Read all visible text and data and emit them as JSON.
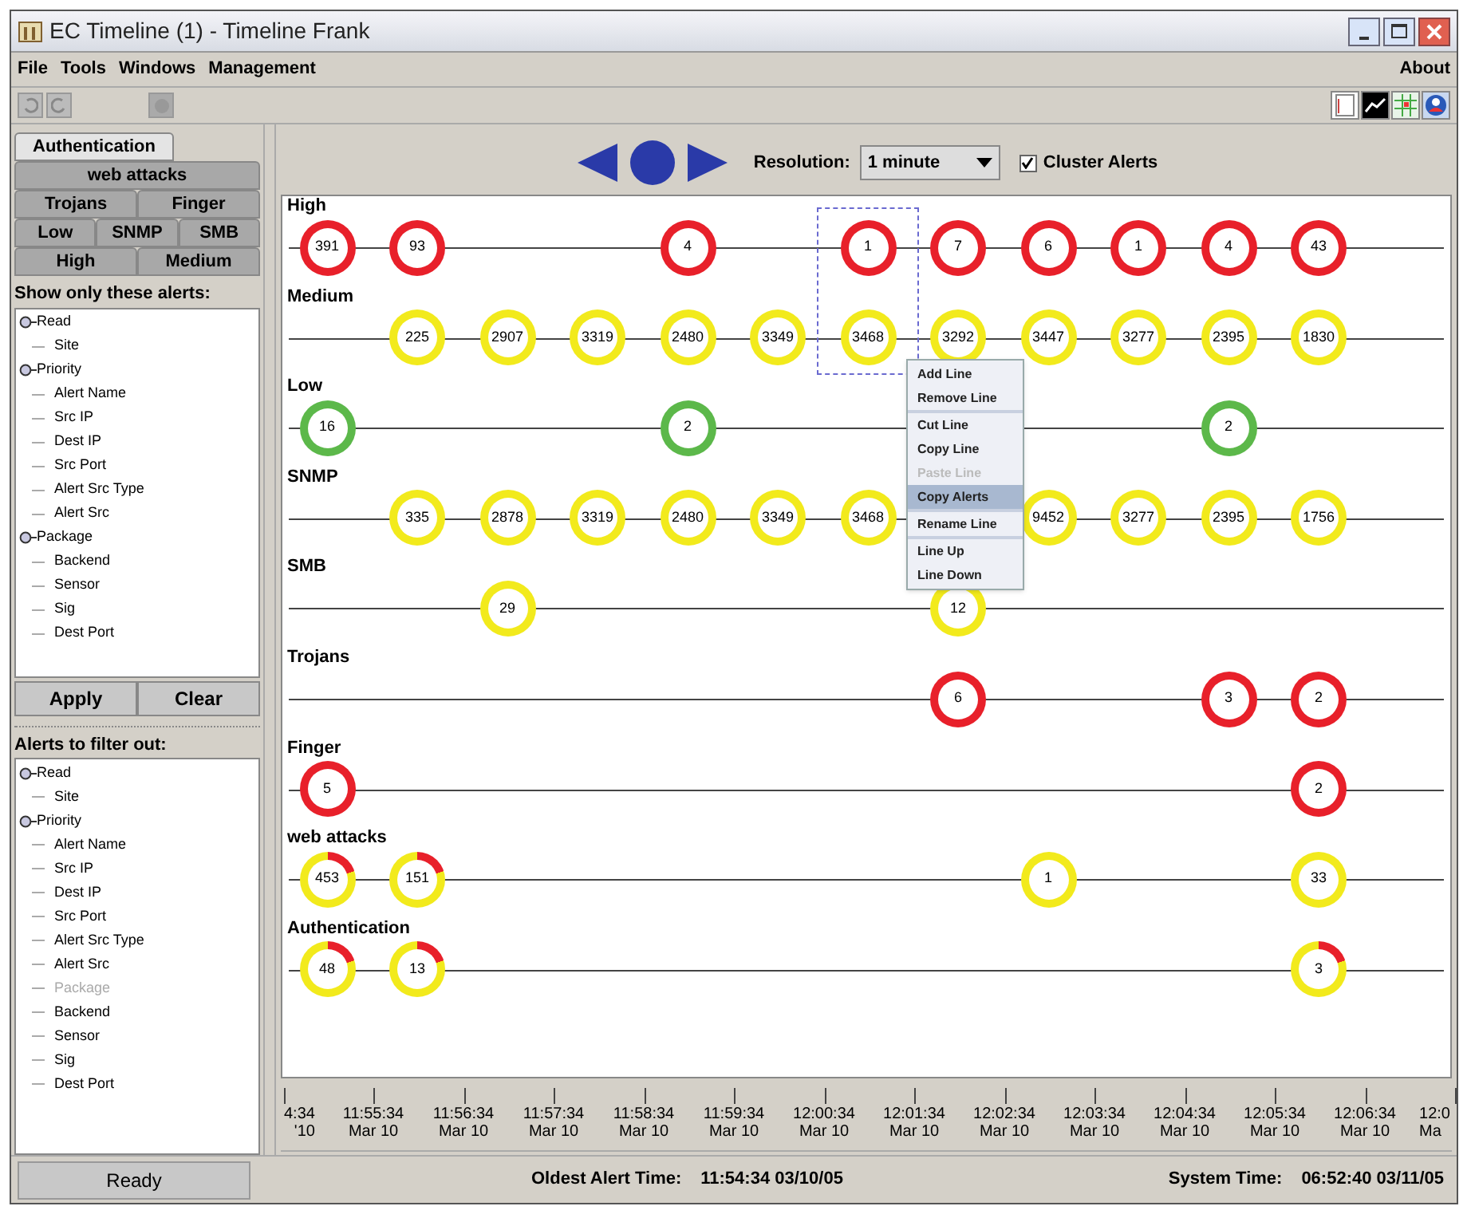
{
  "window": {
    "title": "EC Timeline (1) - Timeline Frank"
  },
  "menu": [
    "File",
    "Tools",
    "Windows",
    "Management"
  ],
  "menu_right": "About",
  "tab_rows": [
    [
      {
        "label": "Authentication",
        "selected": true
      }
    ],
    [
      {
        "label": "web attacks",
        "selected": false
      }
    ],
    [
      {
        "label": "Trojans",
        "selected": false
      },
      {
        "label": "Finger",
        "selected": false
      }
    ],
    [
      {
        "label": "Low",
        "selected": false
      },
      {
        "label": "SNMP",
        "selected": false
      },
      {
        "label": "SMB",
        "selected": false
      }
    ],
    [
      {
        "label": "High",
        "selected": false
      },
      {
        "label": "Medium",
        "selected": false
      }
    ]
  ],
  "show_filter": {
    "title": "Show only these alerts:",
    "tree": [
      {
        "label": "Read",
        "disabled": false,
        "children": [
          {
            "label": "Site",
            "disabled": false
          }
        ]
      },
      {
        "label": "Priority",
        "disabled": false,
        "children": [
          {
            "label": "Alert Name",
            "disabled": false
          },
          {
            "label": "Src IP",
            "disabled": false
          },
          {
            "label": "Dest IP",
            "disabled": false
          },
          {
            "label": "Src Port",
            "disabled": false
          },
          {
            "label": "Alert Src Type",
            "disabled": false
          },
          {
            "label": "Alert Src",
            "disabled": false
          }
        ]
      },
      {
        "label": "Package",
        "disabled": false,
        "children": [
          {
            "label": "Backend",
            "disabled": false
          },
          {
            "label": "Sensor",
            "disabled": false
          },
          {
            "label": "Sig",
            "disabled": false
          },
          {
            "label": "Dest Port",
            "disabled": false
          }
        ]
      }
    ]
  },
  "buttons": [
    "Apply",
    "Clear"
  ],
  "out_filter": {
    "title": "Alerts to filter out:",
    "tree": [
      {
        "label": "Read",
        "disabled": false,
        "children": [
          {
            "label": "Site",
            "disabled": false
          }
        ]
      },
      {
        "label": "Priority",
        "disabled": false,
        "children": [
          {
            "label": "Alert Name",
            "disabled": false
          },
          {
            "label": "Src IP",
            "disabled": false
          },
          {
            "label": "Dest IP",
            "disabled": false
          },
          {
            "label": "Src Port",
            "disabled": false
          },
          {
            "label": "Alert Src Type",
            "disabled": false
          },
          {
            "label": "Alert Src",
            "disabled": false
          },
          {
            "label": "Package",
            "disabled": true
          },
          {
            "label": "Backend",
            "disabled": false
          },
          {
            "label": "Sensor",
            "disabled": false
          },
          {
            "label": "Sig",
            "disabled": false
          },
          {
            "label": "Dest Port",
            "disabled": false
          }
        ]
      }
    ]
  },
  "controls": {
    "resolution_label": "Resolution:",
    "resolution": "1 minute",
    "cluster": {
      "label": "Cluster Alerts",
      "checked": true
    }
  },
  "lanes": [
    {
      "label": "High",
      "bubbles": [
        {
          "count": "391",
          "color": "#e8202a",
          "kind": "plain",
          "selected": false
        },
        {
          "count": "93",
          "color": "#e8202a",
          "kind": "plain",
          "selected": false
        },
        {
          "kind": "none"
        },
        {
          "kind": "none"
        },
        {
          "count": "4",
          "color": "#e8202a",
          "kind": "plain",
          "selected": false
        },
        {
          "kind": "none"
        },
        {
          "count": "1",
          "color": "#e8202a",
          "kind": "plain",
          "selected": true
        },
        {
          "count": "7",
          "color": "#e8202a",
          "kind": "plain",
          "selected": false
        },
        {
          "count": "6",
          "color": "#e8202a",
          "kind": "plain",
          "selected": false
        },
        {
          "count": "1",
          "color": "#e8202a",
          "kind": "plain",
          "selected": false
        },
        {
          "count": "4",
          "color": "#e8202a",
          "kind": "plain",
          "selected": false
        },
        {
          "count": "43",
          "color": "#e8202a",
          "kind": "plain",
          "selected": false
        }
      ]
    },
    {
      "label": "Medium",
      "bubbles": [
        {
          "kind": "none"
        },
        {
          "count": "225",
          "color": "#f2ea1c",
          "kind": "plain",
          "selected": false
        },
        {
          "count": "2907",
          "color": "#f2ea1c",
          "kind": "plain",
          "selected": false
        },
        {
          "count": "3319",
          "color": "#f2ea1c",
          "kind": "plain",
          "selected": false
        },
        {
          "count": "2480",
          "color": "#f2ea1c",
          "kind": "plain",
          "selected": false
        },
        {
          "count": "3349",
          "color": "#f2ea1c",
          "kind": "plain",
          "selected": false
        },
        {
          "count": "3468",
          "color": "#f2ea1c",
          "kind": "plain",
          "selected": true
        },
        {
          "count": "3292",
          "color": "#f2ea1c",
          "kind": "plain",
          "selected": false
        },
        {
          "count": "3447",
          "color": "#f2ea1c",
          "kind": "plain",
          "selected": false
        },
        {
          "count": "3277",
          "color": "#f2ea1c",
          "kind": "plain",
          "selected": false
        },
        {
          "count": "2395",
          "color": "#f2ea1c",
          "kind": "plain",
          "selected": false
        },
        {
          "count": "1830",
          "color": "#f2ea1c",
          "kind": "plain",
          "selected": false
        }
      ]
    },
    {
      "label": "Low",
      "bubbles": [
        {
          "count": "16",
          "color": "#5cb84a",
          "kind": "plain",
          "selected": false
        },
        {
          "kind": "none"
        },
        {
          "kind": "none"
        },
        {
          "kind": "none"
        },
        {
          "count": "2",
          "color": "#5cb84a",
          "kind": "plain",
          "selected": false
        },
        {
          "kind": "none"
        },
        {
          "kind": "none"
        },
        {
          "kind": "none"
        },
        {
          "kind": "none"
        },
        {
          "kind": "none"
        },
        {
          "count": "2",
          "color": "#5cb84a",
          "kind": "plain",
          "selected": false
        }
      ]
    },
    {
      "label": "SNMP",
      "bubbles": [
        {
          "kind": "none"
        },
        {
          "count": "335",
          "color": "#f2ea1c",
          "kind": "plain",
          "selected": false
        },
        {
          "count": "2878",
          "color": "#f2ea1c",
          "kind": "plain",
          "selected": false
        },
        {
          "count": "3319",
          "color": "#f2ea1c",
          "kind": "plain",
          "selected": false
        },
        {
          "count": "2480",
          "color": "#f2ea1c",
          "kind": "plain",
          "selected": false
        },
        {
          "count": "3349",
          "color": "#f2ea1c",
          "kind": "plain",
          "selected": false
        },
        {
          "count": "3468",
          "color": "#f2ea1c",
          "kind": "plain",
          "selected": false
        },
        {
          "kind": "none"
        },
        {
          "count": "9452",
          "color": "#f2ea1c",
          "kind": "plain",
          "selected": false
        },
        {
          "count": "3277",
          "color": "#f2ea1c",
          "kind": "plain",
          "selected": false
        },
        {
          "count": "2395",
          "color": "#f2ea1c",
          "kind": "plain",
          "selected": false
        },
        {
          "count": "1756",
          "color": "#f2ea1c",
          "kind": "plain",
          "selected": false
        }
      ]
    },
    {
      "label": "SMB",
      "bubbles": [
        {
          "kind": "none"
        },
        {
          "kind": "none"
        },
        {
          "count": "29",
          "color": "#f2ea1c",
          "kind": "plain",
          "selected": false
        },
        {
          "kind": "none"
        },
        {
          "kind": "none"
        },
        {
          "kind": "none"
        },
        {
          "kind": "none"
        },
        {
          "count": "12",
          "color": "#f2ea1c",
          "kind": "plain",
          "selected": false
        }
      ]
    },
    {
      "label": "Trojans",
      "bubbles": [
        {
          "kind": "none"
        },
        {
          "kind": "none"
        },
        {
          "kind": "none"
        },
        {
          "kind": "none"
        },
        {
          "kind": "none"
        },
        {
          "kind": "none"
        },
        {
          "kind": "none"
        },
        {
          "count": "6",
          "color": "#e8202a",
          "kind": "plain",
          "selected": false
        },
        {
          "kind": "none"
        },
        {
          "kind": "none"
        },
        {
          "count": "3",
          "color": "#e8202a",
          "kind": "plain",
          "selected": false
        },
        {
          "count": "2",
          "color": "#e8202a",
          "kind": "plain",
          "selected": false
        }
      ]
    },
    {
      "label": "Finger",
      "bubbles": [
        {
          "count": "5",
          "color": "#e8202a",
          "kind": "plain",
          "selected": false
        },
        {
          "kind": "none"
        },
        {
          "kind": "none"
        },
        {
          "kind": "none"
        },
        {
          "kind": "none"
        },
        {
          "kind": "none"
        },
        {
          "kind": "none"
        },
        {
          "kind": "none"
        },
        {
          "kind": "none"
        },
        {
          "kind": "none"
        },
        {
          "kind": "none"
        },
        {
          "count": "2",
          "color": "#e8202a",
          "kind": "plain",
          "selected": false
        }
      ]
    },
    {
      "label": "web attacks",
      "bubbles": [
        {
          "count": "453",
          "color": "#f2ea1c",
          "kind": "split",
          "selected": false
        },
        {
          "count": "151",
          "color": "#f2ea1c",
          "kind": "split",
          "selected": false
        },
        {
          "kind": "none"
        },
        {
          "kind": "none"
        },
        {
          "kind": "none"
        },
        {
          "kind": "none"
        },
        {
          "kind": "none"
        },
        {
          "kind": "none"
        },
        {
          "count": "1",
          "color": "#f2ea1c",
          "kind": "plain",
          "selected": false
        },
        {
          "kind": "none"
        },
        {
          "kind": "none"
        },
        {
          "count": "33",
          "color": "#f2ea1c",
          "kind": "plain",
          "selected": false
        }
      ]
    },
    {
      "label": "Authentication",
      "bubbles": [
        {
          "count": "48",
          "color": "#f2ea1c",
          "kind": "split",
          "selected": false
        },
        {
          "count": "13",
          "color": "#f2ea1c",
          "kind": "split",
          "selected": false
        },
        {
          "kind": "none"
        },
        {
          "kind": "none"
        },
        {
          "kind": "none"
        },
        {
          "kind": "none"
        },
        {
          "kind": "none"
        },
        {
          "kind": "none"
        },
        {
          "kind": "none"
        },
        {
          "kind": "none"
        },
        {
          "kind": "none"
        },
        {
          "count": "3",
          "color": "#f2ea1c",
          "kind": "split",
          "selected": false
        }
      ]
    }
  ],
  "context_menu": [
    [
      {
        "label": "Add Line",
        "disabled": false,
        "selected": false
      },
      {
        "label": "Remove Line",
        "disabled": false,
        "selected": false
      }
    ],
    [
      {
        "label": "Cut Line",
        "disabled": false,
        "selected": false
      },
      {
        "label": "Copy Line",
        "disabled": false,
        "selected": false
      },
      {
        "label": "Paste Line",
        "disabled": true,
        "selected": false
      },
      {
        "label": "Copy Alerts",
        "disabled": false,
        "selected": true
      }
    ],
    [
      {
        "label": "Rename Line",
        "disabled": false,
        "selected": false
      }
    ],
    [
      {
        "label": "Line Up",
        "disabled": false,
        "selected": false
      },
      {
        "label": "Line Down",
        "disabled": false,
        "selected": false
      }
    ]
  ],
  "axis": [
    {
      "time": "4:34",
      "date": "'10"
    },
    {
      "time": "11:55:34",
      "date": "Mar 10"
    },
    {
      "time": "11:56:34",
      "date": "Mar 10"
    },
    {
      "time": "11:57:34",
      "date": "Mar 10"
    },
    {
      "time": "11:58:34",
      "date": "Mar 10"
    },
    {
      "time": "11:59:34",
      "date": "Mar 10"
    },
    {
      "time": "12:00:34",
      "date": "Mar 10"
    },
    {
      "time": "12:01:34",
      "date": "Mar 10"
    },
    {
      "time": "12:02:34",
      "date": "Mar 10"
    },
    {
      "time": "12:03:34",
      "date": "Mar 10"
    },
    {
      "time": "12:04:34",
      "date": "Mar 10"
    },
    {
      "time": "12:05:34",
      "date": "Mar 10"
    },
    {
      "time": "12:06:34",
      "date": "Mar 10"
    },
    {
      "time": "12:0",
      "date": "Ma"
    }
  ],
  "status": {
    "state": "Ready",
    "oldest_label": "Oldest Alert Time:",
    "oldest": "11:54:34 03/10/05",
    "system_label": "System Time:",
    "system": "06:52:40 03/11/05"
  }
}
